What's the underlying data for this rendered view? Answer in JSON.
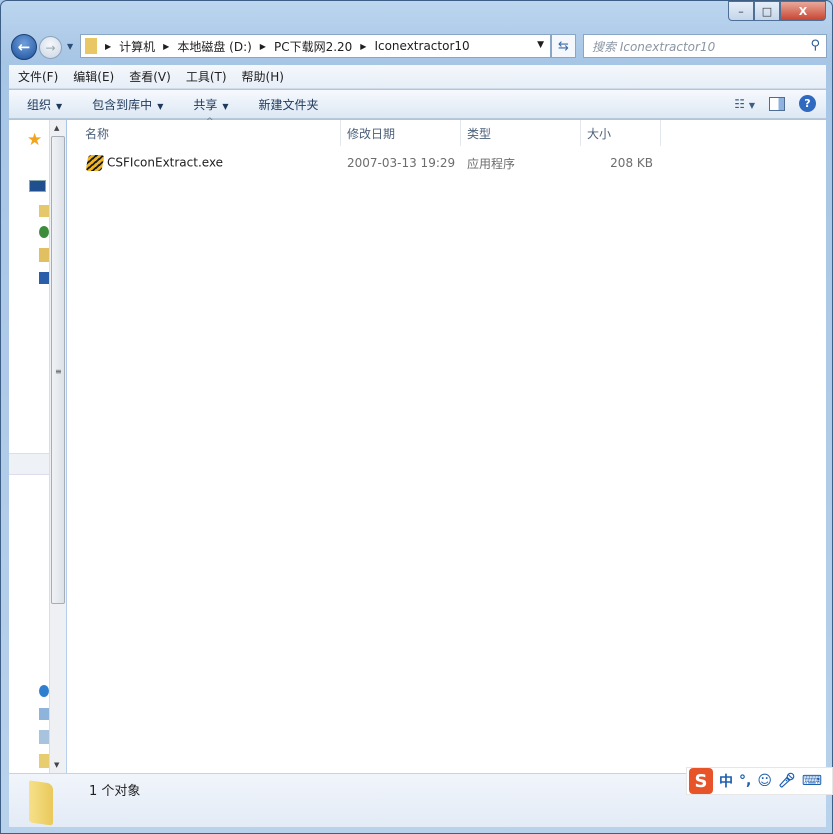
{
  "window": {
    "min": "–",
    "max": "□",
    "close": "X"
  },
  "nav": {
    "back": "←",
    "forward": "→",
    "breadcrumb": [
      "计算机",
      "本地磁盘 (D:)",
      "PC下载网2.20",
      "Iconextractor10"
    ],
    "search_placeholder": "搜索 Iconextractor10"
  },
  "menu": [
    "文件(F)",
    "编辑(E)",
    "查看(V)",
    "工具(T)",
    "帮助(H)"
  ],
  "toolbar": {
    "organize": "组织",
    "include": "包含到库中",
    "share": "共享",
    "new_folder": "新建文件夹",
    "help": "?"
  },
  "columns": [
    "名称",
    "修改日期",
    "类型",
    "大小"
  ],
  "files": [
    {
      "name": "CSFIconExtract.exe",
      "modified": "2007-03-13 19:29",
      "type": "应用程序",
      "size": "208 KB"
    }
  ],
  "status": {
    "count": "1 个对象"
  },
  "ime": {
    "logo": "S",
    "mode": "中",
    "punct": "°,"
  }
}
